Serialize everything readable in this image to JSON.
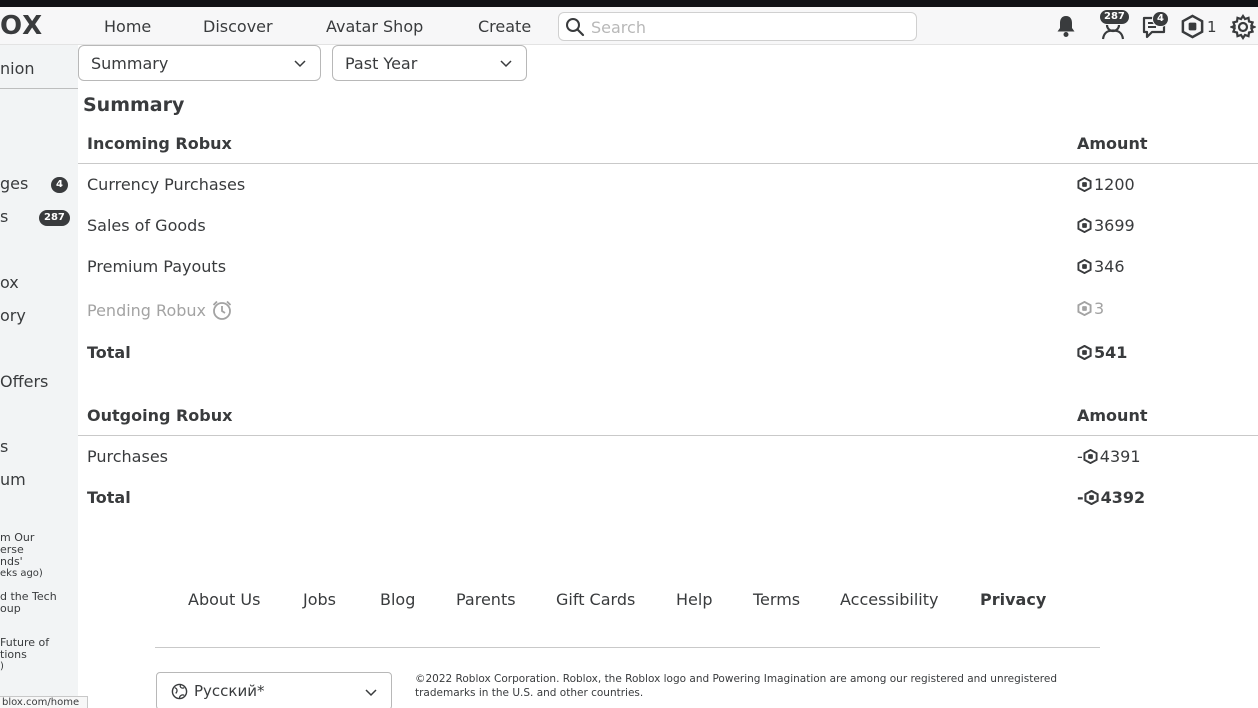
{
  "colors": {
    "text": "#393b3d",
    "muted": "#a3a3a3",
    "page_bg": "#f2f4f5",
    "content_bg": "#ffffff",
    "topstrip": "#111216"
  },
  "header": {
    "logo_text": "OX",
    "nav": [
      "Home",
      "Discover",
      "Avatar Shop",
      "Create"
    ],
    "search_placeholder": "Search",
    "friends_badge": "287",
    "messages_badge": "4",
    "robux_balance": "1",
    "icons": [
      "bell-icon",
      "friends-icon",
      "chat-icon",
      "robux-icon",
      "gear-icon"
    ]
  },
  "sidebar": {
    "items": [
      "nion",
      "",
      "ges",
      "s",
      "",
      "ox",
      "ory",
      "Offers",
      "",
      "s",
      "um"
    ],
    "messages_badge": "4",
    "friends_badge": "287",
    "events": [
      {
        "title_lines": [
          "m Our",
          "erse",
          "nds'"
        ],
        "time": "eks ago)"
      },
      {
        "title_lines": [
          "d the Tech",
          "oup"
        ],
        "time": ""
      },
      {
        "title_lines": [
          "Future of",
          "tions"
        ],
        "time": ")"
      }
    ]
  },
  "filters": {
    "type": "Summary",
    "period": "Past Year"
  },
  "summary": {
    "title": "Summary",
    "incoming": {
      "header": "Incoming Robux",
      "amount_header": "Amount",
      "rows": [
        {
          "label": "Currency Purchases",
          "amount": "1200"
        },
        {
          "label": "Sales of Goods",
          "amount": "3699"
        },
        {
          "label": "Premium Payouts",
          "amount": "346"
        },
        {
          "label": "Pending Robux",
          "amount": "3"
        }
      ],
      "total_label": "Total",
      "total_amount": "541"
    },
    "outgoing": {
      "header": "Outgoing Robux",
      "amount_header": "Amount",
      "rows": [
        {
          "label": "Purchases",
          "sign": "-",
          "amount": "4391"
        }
      ],
      "total_label": "Total",
      "total_sign": "-",
      "total_amount": "4392"
    }
  },
  "footer": {
    "links": [
      "About Us",
      "Jobs",
      "Blog",
      "Parents",
      "Gift Cards",
      "Help",
      "Terms",
      "Accessibility",
      "Privacy"
    ],
    "language": "Русский*",
    "copyright_line1": "©2022 Roblox Corporation. Roblox, the Roblox logo and Powering Imagination are among our registered and unregistered",
    "copyright_line2": "trademarks in the U.S. and other countries."
  },
  "status_url": "blox.com/home"
}
